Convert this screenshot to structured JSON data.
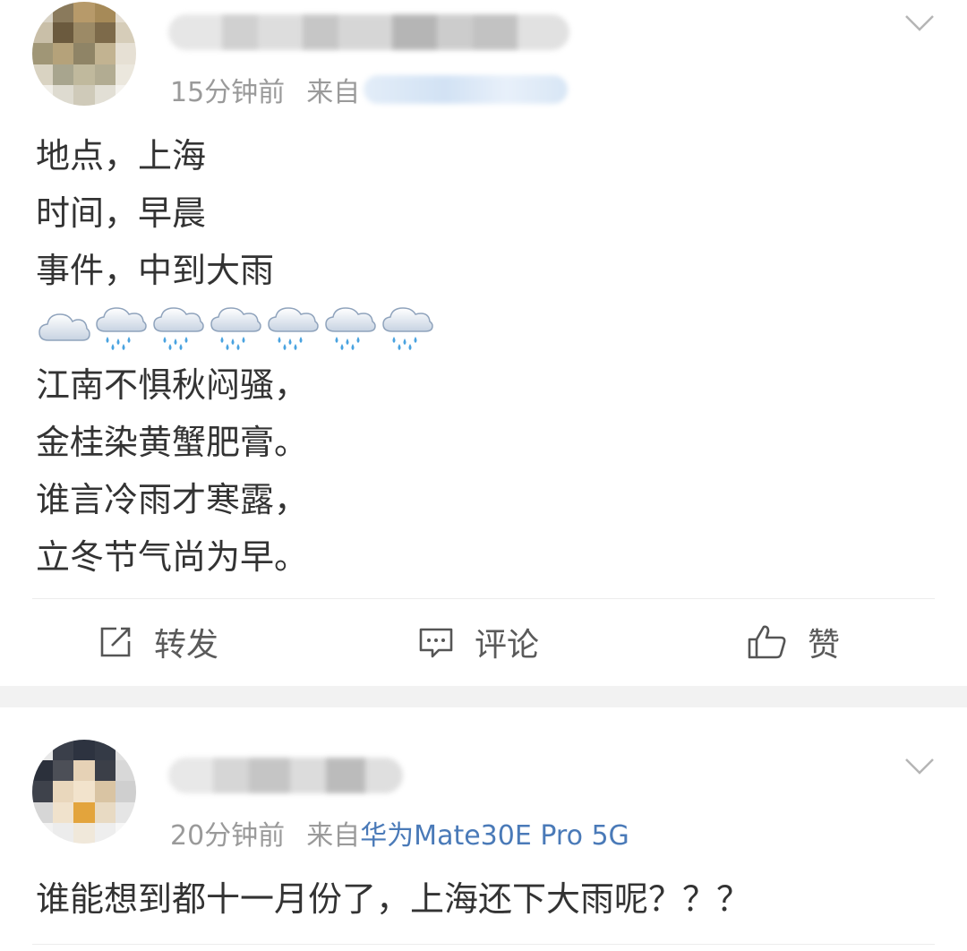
{
  "post1": {
    "time": "15分钟前",
    "source_prefix": "来自",
    "lines_before_emoji": [
      "地点，上海",
      "时间，早晨",
      "事件，中到大雨"
    ],
    "emoji": [
      "cloud-icon",
      "rain-cloud-icon",
      "rain-cloud-icon",
      "rain-cloud-icon",
      "rain-cloud-icon",
      "rain-cloud-icon",
      "rain-cloud-icon"
    ],
    "lines_after_emoji": [
      "江南不惧秋闷骚，",
      "金桂染黄蟹肥膏。",
      "谁言冷雨才寒露，",
      "立冬节气尚为早。"
    ],
    "actions": {
      "repost": "转发",
      "comment": "评论",
      "like": "赞"
    }
  },
  "post2": {
    "time": "20分钟前",
    "source_prefix": "来自",
    "device": "华为Mate30E Pro 5G",
    "text": "谁能想到都十一月份了，上海还下大雨呢？？？"
  },
  "colors": {
    "link_blue": "#4a7ab8",
    "meta_gray": "#9a9a9a",
    "text": "#333333",
    "separator": "#f2f2f2"
  }
}
